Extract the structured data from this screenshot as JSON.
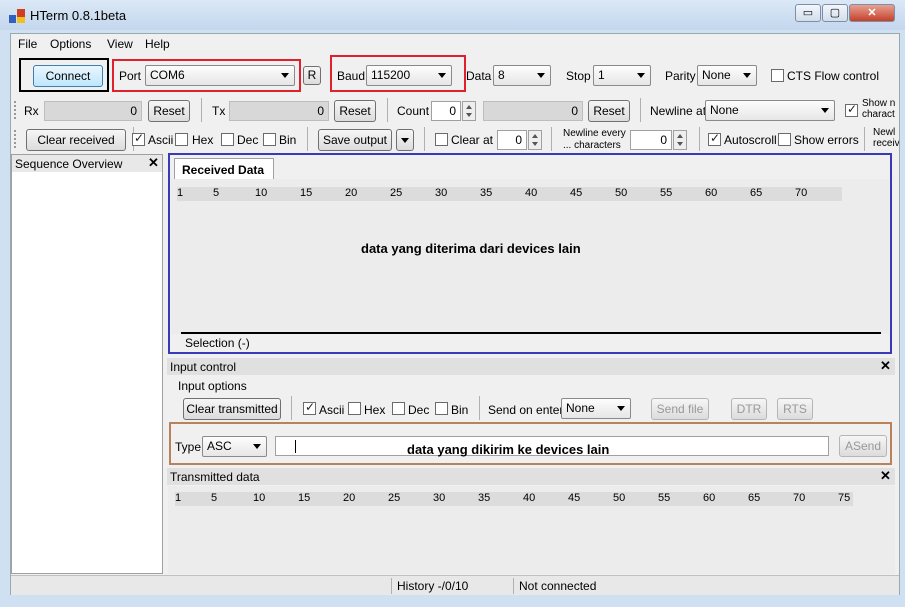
{
  "window": {
    "title": "HTerm 0.8.1beta",
    "minimize": "▭",
    "maximize": "▢",
    "close": "✕"
  },
  "menu": [
    "File",
    "Options",
    "View",
    "Help"
  ],
  "connection": {
    "connect_label": "Connect",
    "port_label": "Port",
    "port_value": "COM6",
    "refresh_label": "R",
    "baud_label": "Baud",
    "baud_value": "115200",
    "data_label": "Data",
    "data_value": "8",
    "stop_label": "Stop",
    "stop_value": "1",
    "parity_label": "Parity",
    "parity_value": "None",
    "cts_label": "CTS Flow control"
  },
  "counters": {
    "rx_label": "Rx",
    "rx_value": "0",
    "rx_reset": "Reset",
    "tx_label": "Tx",
    "tx_value": "0",
    "tx_reset": "Reset",
    "count_label": "Count",
    "count_value": "0",
    "count_value2": "0",
    "count_reset": "Reset",
    "newline_label": "Newline at",
    "newline_value": "None",
    "show_newline_label": "Show n charact"
  },
  "receive_toolbar": {
    "clear_received": "Clear received",
    "ascii": "Ascii",
    "hex": "Hex",
    "dec": "Dec",
    "bin": "Bin",
    "save_output": "Save output",
    "clear_at": "Clear at",
    "clear_at_value": "0",
    "newline_every_1": "Newline every",
    "newline_every_2": "... characters",
    "newline_every_value": "0",
    "autoscroll": "Autoscroll",
    "show_errors": "Show errors",
    "newline_receive": "Newl receiv"
  },
  "sequence_overview": {
    "title": "Sequence Overview",
    "close": "✕"
  },
  "received": {
    "tab": "Received Data",
    "ruler": [
      "1",
      "5",
      "10",
      "15",
      "20",
      "25",
      "30",
      "35",
      "40",
      "45",
      "50",
      "55",
      "60",
      "65",
      "70"
    ],
    "annotation": "data yang diterima dari devices lain",
    "selection": "Selection (-)"
  },
  "input_control": {
    "title": "Input control",
    "close": "✕",
    "options_label": "Input options",
    "clear_transmitted": "Clear transmitted",
    "ascii": "Ascii",
    "hex": "Hex",
    "dec": "Dec",
    "bin": "Bin",
    "send_on_enter_label": "Send on enter",
    "send_on_enter_value": "None",
    "send_file": "Send file",
    "dtr": "DTR",
    "rts": "RTS",
    "type_label": "Type",
    "type_value": "ASC",
    "annotation": "data yang dikirim ke devices lain",
    "asend": "ASend"
  },
  "transmitted": {
    "title": "Transmitted data",
    "close": "✕",
    "ruler": [
      "1",
      "5",
      "10",
      "15",
      "20",
      "25",
      "30",
      "35",
      "40",
      "45",
      "50",
      "55",
      "60",
      "65",
      "70",
      "75"
    ]
  },
  "status": {
    "history": "History -/0/10",
    "connection": "Not connected"
  },
  "colors": {
    "black_box": "#000000",
    "red_box": "#e0202a",
    "blue_box": "#3a3ab8",
    "orange_box": "#b8825a"
  }
}
